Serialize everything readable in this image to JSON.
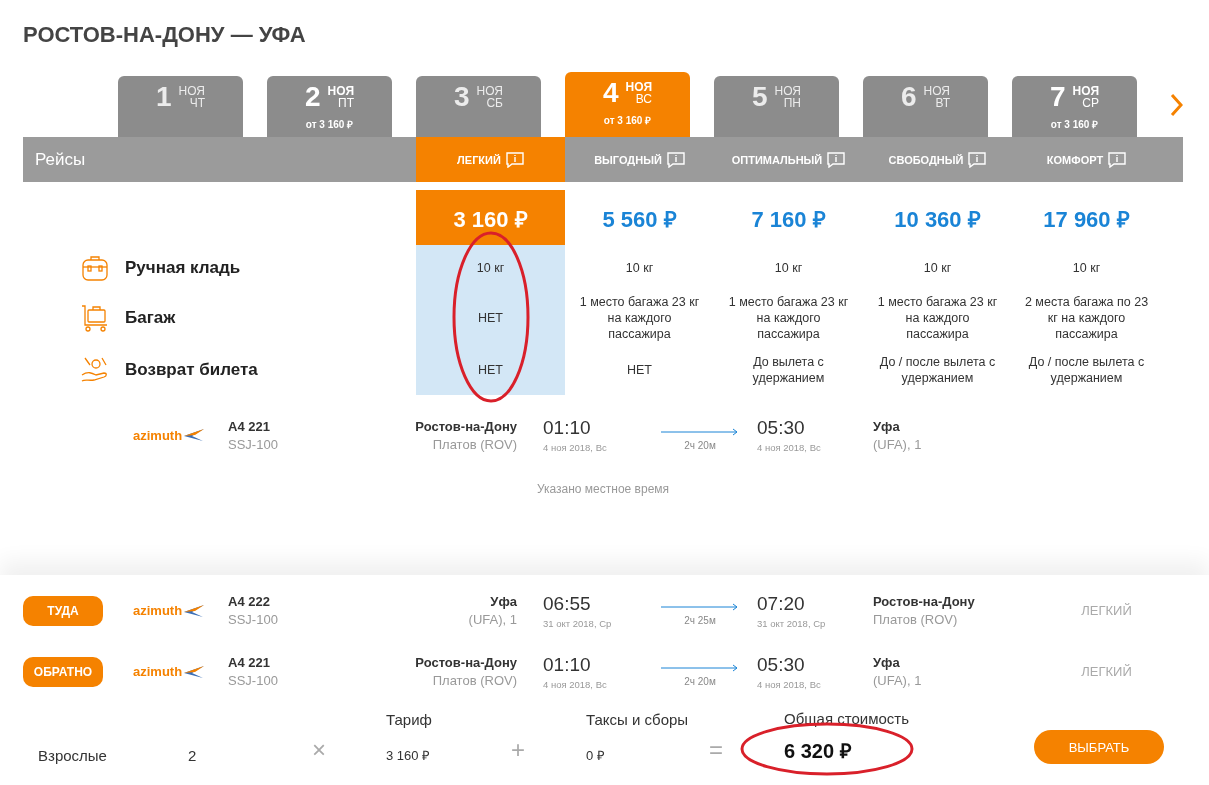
{
  "title": "РОСТОВ-НА-ДОНУ — УФА",
  "dates": [
    {
      "day": "1",
      "month": "НОЯ",
      "weekday": "ЧТ",
      "available": false,
      "selected": false
    },
    {
      "day": "2",
      "month": "НОЯ",
      "weekday": "ПТ",
      "price": "от 3 160 ₽",
      "available": true,
      "selected": false
    },
    {
      "day": "3",
      "month": "НОЯ",
      "weekday": "СБ",
      "available": false,
      "selected": false
    },
    {
      "day": "4",
      "month": "НОЯ",
      "weekday": "ВС",
      "price": "от 3 160 ₽",
      "available": true,
      "selected": true
    },
    {
      "day": "5",
      "month": "НОЯ",
      "weekday": "ПН",
      "available": false,
      "selected": false
    },
    {
      "day": "6",
      "month": "НОЯ",
      "weekday": "ВТ",
      "available": false,
      "selected": false
    },
    {
      "day": "7",
      "month": "НОЯ",
      "weekday": "СР",
      "price": "от 3 160 ₽",
      "available": true,
      "selected": false
    }
  ],
  "header_label": "Рейсы",
  "features": [
    {
      "kind": "hand_luggage",
      "label": "Ручная кладь"
    },
    {
      "kind": "baggage",
      "label": "Багаж"
    },
    {
      "kind": "refund",
      "label": "Возврат билета"
    }
  ],
  "tariffs": [
    {
      "name": "ЛЕГКИЙ",
      "price": "3 160 ₽",
      "selected": true,
      "values": [
        "10 кг",
        "НЕТ",
        "НЕТ"
      ]
    },
    {
      "name": "ВЫГОДНЫЙ",
      "price": "5 560 ₽",
      "selected": false,
      "values": [
        "10 кг",
        "1 место багажа 23 кг на каждого пассажира",
        "НЕТ"
      ]
    },
    {
      "name": "ОПТИМАЛЬНЫЙ",
      "price": "7 160 ₽",
      "selected": false,
      "values": [
        "10 кг",
        "1 место багажа 23 кг на каждого пассажира",
        "До вылета с удержанием"
      ]
    },
    {
      "name": "СВОБОДНЫЙ",
      "price": "10 360 ₽",
      "selected": false,
      "values": [
        "10 кг",
        "1 место багажа 23 кг на каждого пассажира",
        "До / после вылета с удержанием"
      ]
    },
    {
      "name": "КОМФОРТ",
      "price": "17 960 ₽",
      "selected": false,
      "values": [
        "10 кг",
        "2 места багажа по 23 кг на каждого пассажира",
        "До / после вылета с удержанием"
      ]
    }
  ],
  "flight": {
    "airline": "azimuth",
    "number": "А4 221",
    "aircraft": "SSJ-100",
    "origin_city": "Ростов-на-Дону",
    "origin_airport": "Платов (ROV)",
    "dep_time": "01:10",
    "dep_date": "4 ноя 2018, Вс",
    "duration": "2ч 20м",
    "arr_time": "05:30",
    "arr_date": "4 ноя 2018, Вс",
    "dest_city": "Уфа",
    "dest_airport": "(UFA), 1"
  },
  "note": "Указано местное время",
  "itinerary": [
    {
      "direction": "ТУДА",
      "airline": "azimuth",
      "number": "А4 222",
      "aircraft": "SSJ-100",
      "origin_city": "Уфа",
      "origin_airport": "(UFA), 1",
      "dep_time": "06:55",
      "dep_date": "31 окт 2018, Ср",
      "duration": "2ч 25м",
      "arr_time": "07:20",
      "arr_date": "31 окт 2018, Ср",
      "dest_city": "Ростов-на-Дону",
      "dest_airport": "Платов (ROV)",
      "fare": "ЛЕГКИЙ"
    },
    {
      "direction": "ОБРАТНО",
      "airline": "azimuth",
      "number": "А4 221",
      "aircraft": "SSJ-100",
      "origin_city": "Ростов-на-Дону",
      "origin_airport": "Платов (ROV)",
      "dep_time": "01:10",
      "dep_date": "4 ноя 2018, Вс",
      "duration": "2ч 20м",
      "arr_time": "05:30",
      "arr_date": "4 ноя 2018, Вс",
      "dest_city": "Уфа",
      "dest_airport": "(UFA), 1",
      "fare": "ЛЕГКИЙ"
    }
  ],
  "summary": {
    "passenger_label": "Взрослые",
    "count": "2",
    "times": "×",
    "fare_label": "Тариф",
    "fare": "3 160 ₽",
    "plus": "+",
    "taxes_label": "Таксы и сборы",
    "taxes": "0 ₽",
    "equals": "=",
    "total_label": "Общая стоимость",
    "total": "6 320 ₽",
    "button": "ВЫБРАТЬ"
  }
}
